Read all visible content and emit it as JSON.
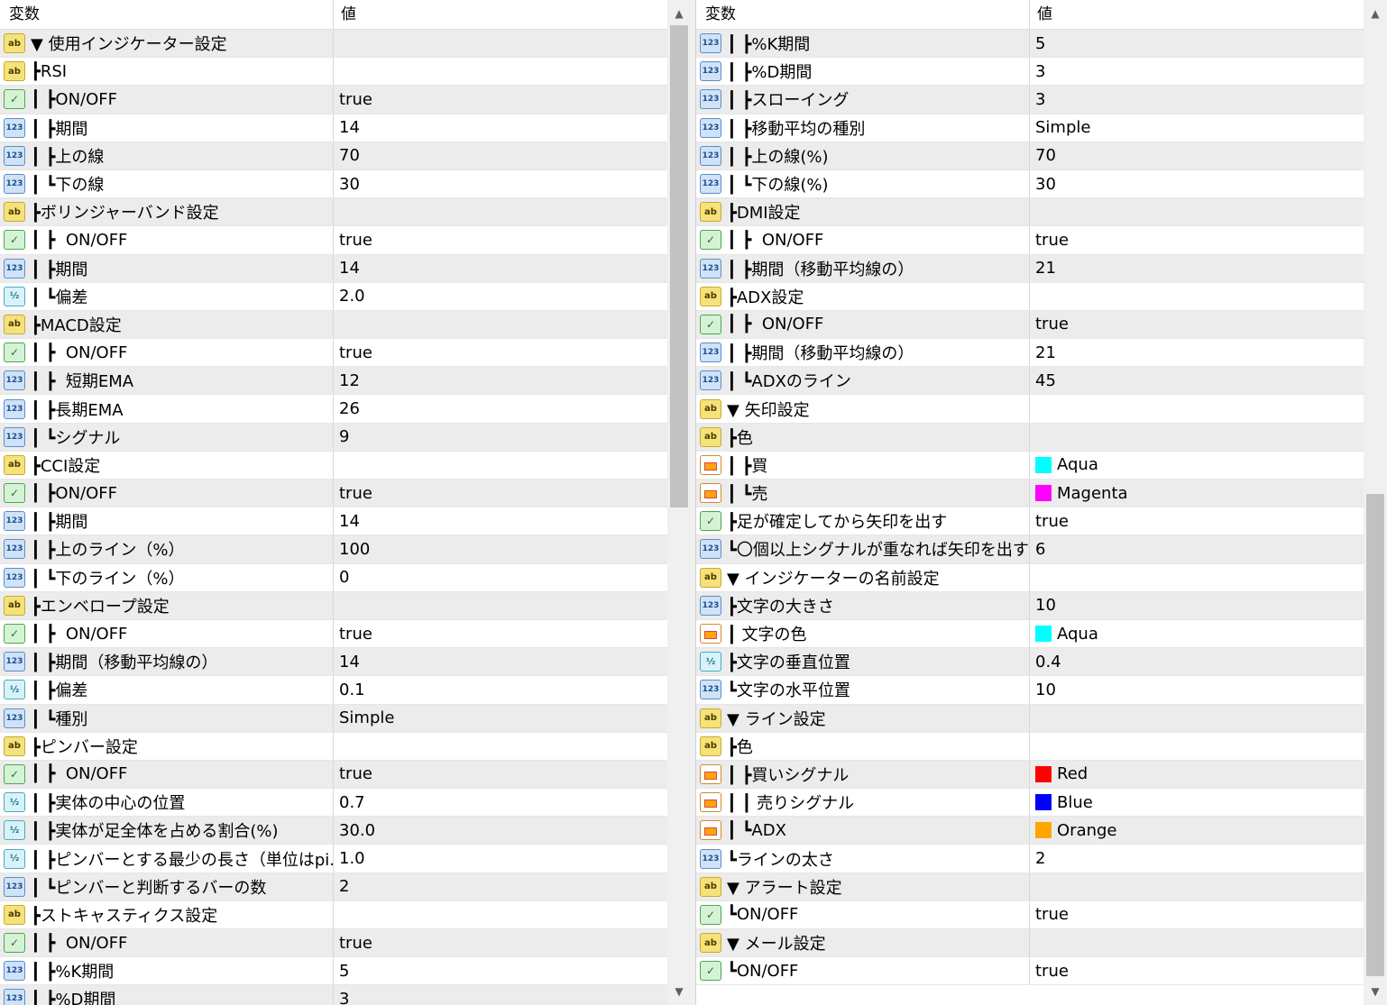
{
  "header": {
    "name_col": "変数",
    "value_col": "値"
  },
  "scroll_arrows": {
    "up": "▲",
    "down": "▼"
  },
  "left_rows": [
    {
      "icon": "ab",
      "name": "▼ 使用インジケーター設定",
      "value": ""
    },
    {
      "icon": "ab",
      "name": "┣RSI",
      "value": ""
    },
    {
      "icon": "bool",
      "name": "┃ ┣ON/OFF",
      "value": "true"
    },
    {
      "icon": "123",
      "name": "┃ ┣期間",
      "value": "14"
    },
    {
      "icon": "123",
      "name": "┃ ┣上の線",
      "value": "70"
    },
    {
      "icon": "123",
      "name": "┃ ┗下の線",
      "value": "30"
    },
    {
      "icon": "ab",
      "name": "┣ボリンジャーバンド設定",
      "value": ""
    },
    {
      "icon": "bool",
      "name": "┃ ┣  ON/OFF",
      "value": "true"
    },
    {
      "icon": "123",
      "name": "┃ ┣期間",
      "value": "14"
    },
    {
      "icon": "dbl",
      "name": "┃ ┗偏差",
      "value": "2.0"
    },
    {
      "icon": "ab",
      "name": "┣MACD設定",
      "value": ""
    },
    {
      "icon": "bool",
      "name": "┃ ┣  ON/OFF",
      "value": "true"
    },
    {
      "icon": "123",
      "name": "┃ ┣  短期EMA",
      "value": "12"
    },
    {
      "icon": "123",
      "name": "┃ ┣長期EMA",
      "value": "26"
    },
    {
      "icon": "123",
      "name": "┃ ┗シグナル",
      "value": "9"
    },
    {
      "icon": "ab",
      "name": "┣CCI設定",
      "value": ""
    },
    {
      "icon": "bool",
      "name": "┃ ┣ON/OFF",
      "value": "true"
    },
    {
      "icon": "123",
      "name": "┃ ┣期間",
      "value": "14"
    },
    {
      "icon": "123",
      "name": "┃ ┣上のライン（%）",
      "value": "100"
    },
    {
      "icon": "123",
      "name": "┃ ┗下のライン（%）",
      "value": "0"
    },
    {
      "icon": "ab",
      "name": "┣エンベロープ設定",
      "value": ""
    },
    {
      "icon": "bool",
      "name": "┃ ┣  ON/OFF",
      "value": "true"
    },
    {
      "icon": "123",
      "name": "┃ ┣期間（移動平均線の）",
      "value": "14"
    },
    {
      "icon": "dbl",
      "name": "┃ ┣偏差",
      "value": "0.1"
    },
    {
      "icon": "123",
      "name": "┃ ┗種別",
      "value": "Simple"
    },
    {
      "icon": "ab",
      "name": "┣ピンバー設定",
      "value": ""
    },
    {
      "icon": "bool",
      "name": "┃ ┣  ON/OFF",
      "value": "true"
    },
    {
      "icon": "dbl",
      "name": "┃ ┣実体の中心の位置",
      "value": "0.7"
    },
    {
      "icon": "dbl",
      "name": "┃ ┣実体が足全体を占める割合(%)",
      "value": "30.0"
    },
    {
      "icon": "dbl",
      "name": "┃ ┣ピンバーとする最少の長さ（単位はpi...",
      "value": "1.0"
    },
    {
      "icon": "123",
      "name": "┃ ┗ピンバーと判断するバーの数",
      "value": "2"
    },
    {
      "icon": "ab",
      "name": "┣ストキャスティクス設定",
      "value": ""
    },
    {
      "icon": "bool",
      "name": "┃ ┣  ON/OFF",
      "value": "true"
    },
    {
      "icon": "123",
      "name": "┃ ┣%K期間",
      "value": "5"
    },
    {
      "icon": "123",
      "name": "┃ ┣%D期間",
      "value": "3"
    }
  ],
  "right_rows": [
    {
      "icon": "123",
      "name": "┃ ┣%K期間",
      "value": "5"
    },
    {
      "icon": "123",
      "name": "┃ ┣%D期間",
      "value": "3"
    },
    {
      "icon": "123",
      "name": "┃ ┣スローイング",
      "value": "3"
    },
    {
      "icon": "123",
      "name": "┃ ┣移動平均の種別",
      "value": "Simple"
    },
    {
      "icon": "123",
      "name": "┃ ┣上の線(%)",
      "value": "70"
    },
    {
      "icon": "123",
      "name": "┃ ┗下の線(%)",
      "value": "30"
    },
    {
      "icon": "ab",
      "name": "┣DMI設定",
      "value": ""
    },
    {
      "icon": "bool",
      "name": "┃ ┣  ON/OFF",
      "value": "true"
    },
    {
      "icon": "123",
      "name": "┃ ┣期間（移動平均線の）",
      "value": "21"
    },
    {
      "icon": "ab",
      "name": "┣ADX設定",
      "value": ""
    },
    {
      "icon": "bool",
      "name": "┃ ┣  ON/OFF",
      "value": "true"
    },
    {
      "icon": "123",
      "name": "┃ ┣期間（移動平均線の）",
      "value": "21"
    },
    {
      "icon": "123",
      "name": "┃ ┗ADXのライン",
      "value": "45"
    },
    {
      "icon": "ab",
      "name": "▼ 矢印設定",
      "value": ""
    },
    {
      "icon": "ab",
      "name": "┣色",
      "value": ""
    },
    {
      "icon": "color",
      "name": "┃ ┣買",
      "value": "Aqua",
      "swatch": "#00ffff"
    },
    {
      "icon": "color",
      "name": "┃ ┗売",
      "value": "Magenta",
      "swatch": "#ff00ff"
    },
    {
      "icon": "bool",
      "name": "┣足が確定してから矢印を出す",
      "value": "true"
    },
    {
      "icon": "123",
      "name": "┗〇個以上シグナルが重なれば矢印を出す",
      "value": "6"
    },
    {
      "icon": "ab",
      "name": "▼ インジケーターの名前設定",
      "value": ""
    },
    {
      "icon": "123",
      "name": "┣文字の大きさ",
      "value": "10"
    },
    {
      "icon": "color",
      "name": "┃ 文字の色",
      "value": "Aqua",
      "swatch": "#00ffff"
    },
    {
      "icon": "dbl",
      "name": "┣文字の垂直位置",
      "value": "0.4"
    },
    {
      "icon": "123",
      "name": "┗文字の水平位置",
      "value": "10"
    },
    {
      "icon": "ab",
      "name": "▼ ライン設定",
      "value": ""
    },
    {
      "icon": "ab",
      "name": "┣色",
      "value": ""
    },
    {
      "icon": "color",
      "name": "┃ ┣買いシグナル",
      "value": "Red",
      "swatch": "#ff0000"
    },
    {
      "icon": "color",
      "name": "┃ ┃ 売りシグナル",
      "value": "Blue",
      "swatch": "#0000ff"
    },
    {
      "icon": "color",
      "name": "┃ ┗ADX",
      "value": "Orange",
      "swatch": "#ffa500"
    },
    {
      "icon": "123",
      "name": "┗ラインの太さ",
      "value": "2"
    },
    {
      "icon": "ab",
      "name": "▼ アラート設定",
      "value": ""
    },
    {
      "icon": "bool",
      "name": "┗ON/OFF",
      "value": "true"
    },
    {
      "icon": "ab",
      "name": "▼ メール設定",
      "value": ""
    },
    {
      "icon": "bool",
      "name": "┗ON/OFF",
      "value": "true"
    }
  ]
}
